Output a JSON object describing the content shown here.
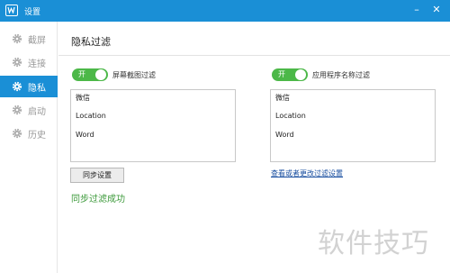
{
  "window": {
    "title": "设置",
    "minimize_glyph": "–",
    "close_glyph": "✕",
    "accent": "#1a8fd6"
  },
  "sidebar": {
    "items": [
      {
        "label": "截屏",
        "icon": "gear-icon",
        "active": false
      },
      {
        "label": "连接",
        "icon": "gear-icon",
        "active": false
      },
      {
        "label": "隐私",
        "icon": "gear-icon",
        "active": true
      },
      {
        "label": "启动",
        "icon": "gear-icon",
        "active": false
      },
      {
        "label": "历史",
        "icon": "gear-icon",
        "active": false
      }
    ]
  },
  "main": {
    "title": "隐私过滤",
    "screenshot_filter": {
      "toggle_text": "开",
      "label": "屏幕截图过滤",
      "on": true,
      "items": [
        "微信",
        "Location",
        "Word"
      ]
    },
    "app_name_filter": {
      "toggle_text": "开",
      "label": "应用程序名称过滤",
      "on": true,
      "items": [
        "微信",
        "Location",
        "Word"
      ]
    },
    "sync_button": "同步设置",
    "sync_status": "同步过滤成功",
    "filter_link": "查看或者更改过滤设置"
  },
  "watermark": "软件技巧",
  "colors": {
    "toggle_on": "#4cb848",
    "status_success": "#3d9a3b",
    "link": "#1a4fa0"
  }
}
